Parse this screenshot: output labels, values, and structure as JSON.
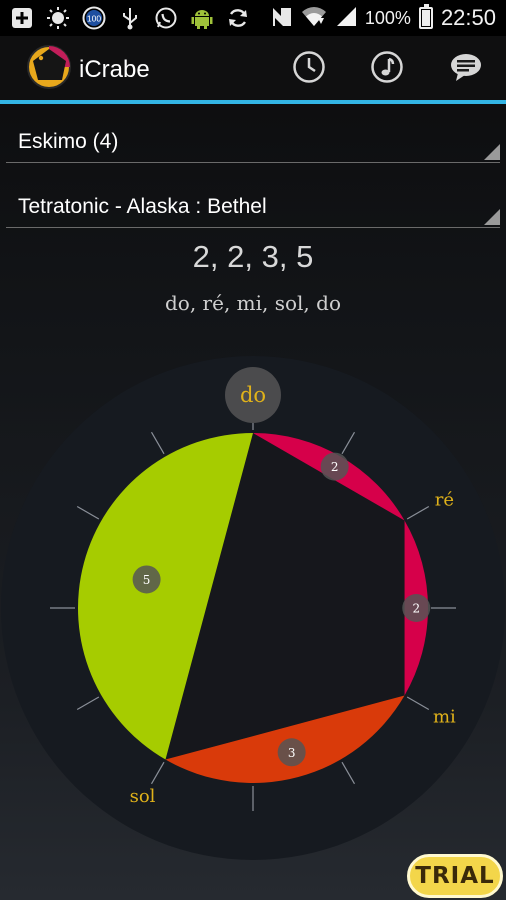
{
  "status_bar": {
    "notification_icons": [
      "add-box-icon",
      "brightness-icon",
      "badge-100-icon",
      "usb-icon",
      "whatsapp-icon",
      "android-icon",
      "sync-icon"
    ],
    "badge_text": "100",
    "battery_level_percent": 100,
    "battery_text": "100%",
    "time": "22:50"
  },
  "action_bar": {
    "title": "iCrabe",
    "accent_color": "#33b5e5",
    "actions": [
      "clock-icon",
      "music-note-icon",
      "chat-icon"
    ]
  },
  "scale_family": {
    "selected": "Eskimo (4)"
  },
  "scale_name": {
    "selected": "Tetratonic - Alaska : Bethel"
  },
  "intervals_text": "2, 2, 3, 5",
  "notes_text": "do, ré, mi, sol, do",
  "wheel": {
    "divisions": 12,
    "root_label": "do",
    "notes": [
      {
        "name": "do",
        "step": 0
      },
      {
        "name": "ré",
        "step": 2
      },
      {
        "name": "mi",
        "step": 4
      },
      {
        "name": "sol",
        "step": 7
      }
    ],
    "segments": [
      {
        "interval": "2",
        "from": 0,
        "to": 2,
        "color": "#d6004a"
      },
      {
        "interval": "2",
        "from": 2,
        "to": 4,
        "color": "#d6004a"
      },
      {
        "interval": "3",
        "from": 4,
        "to": 7,
        "color": "#d93a0a"
      },
      {
        "interval": "5",
        "from": 7,
        "to": 12,
        "color": "#a6cc00"
      }
    ],
    "note_label_color": "#e0b21a"
  },
  "trial_badge": "TRIAL"
}
